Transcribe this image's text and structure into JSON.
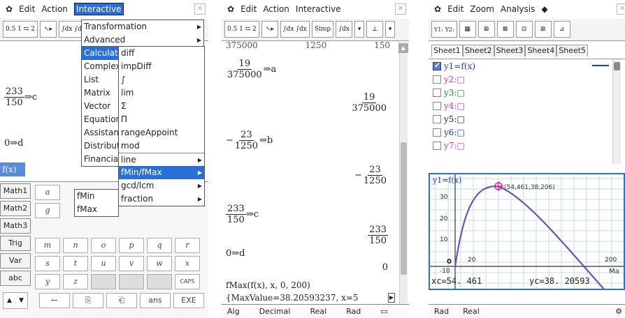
{
  "panel1": {
    "menubar": {
      "gear": "✿",
      "edit": "Edit",
      "action": "Action",
      "interactive": "Interactive"
    },
    "toolbar": [
      "0.5 1 ⇆ 2",
      "↖▸",
      "∫dx ∫dx"
    ],
    "work": {
      "frac_num": "233",
      "frac_den": "150",
      "assign1": "⇒c",
      "assign2": "0⇒d",
      "fx_tag": "f(x)"
    },
    "menu1": [
      "Transformation",
      "Advanced",
      "Calculation",
      "Complex",
      "List",
      "Matrix",
      "Vector",
      "Equation",
      "Assistant",
      "Distribution",
      "Financial"
    ],
    "menu2": [
      "diff",
      "impDiff",
      "∫",
      "lim",
      "Σ",
      "Π",
      "rangeAppoint",
      "mod",
      "line",
      "fMin/fMax",
      "gcd/lcm",
      "fraction"
    ],
    "menu3": [
      "fMin",
      "fMax"
    ],
    "keytabs": [
      "Math1",
      "Math2",
      "Math3",
      "Trig",
      "Var",
      "abc"
    ],
    "keys_row1": [
      "a",
      "g"
    ],
    "keys_row3": [
      "m",
      "n",
      "o",
      "p",
      "q",
      "r"
    ],
    "keys_row4": [
      "s",
      "t",
      "u",
      "v",
      "w",
      "x"
    ],
    "keys_row5": [
      "y",
      "z",
      "",
      "",
      "",
      "CAPS"
    ],
    "bottom_keys": [
      "←",
      "⎘",
      "⎗",
      "ans",
      "EXE"
    ],
    "scroll_up": "▲",
    "scroll_down": "▼"
  },
  "panel2": {
    "menubar": {
      "gear": "✿",
      "edit": "Edit",
      "action": "Action",
      "interactive": "Interactive"
    },
    "toolbar": [
      "0.5 1 ⇆ 2",
      "↖▸",
      "∫dx ∫dx",
      "Simp",
      "∫dx",
      "▾",
      "⊥",
      "▾"
    ],
    "top_row": [
      "375000",
      "1250",
      "150"
    ],
    "lines": {
      "a_num": "19",
      "a_den": "375000",
      "a_assign": "⇒a",
      "r1_num": "19",
      "r1_den": "375000",
      "b_sign": "−",
      "b_num": "23",
      "b_den": "1250",
      "b_assign": "⇒b",
      "r2_sign": "−",
      "r2_num": "23",
      "r2_den": "1250",
      "c_num": "233",
      "c_den": "150",
      "c_assign": "⇒c",
      "r3_num": "233",
      "r3_den": "150",
      "d_assign": "0⇒d",
      "r4": "0",
      "input": "fMax(f(x), x, 0, 200)",
      "output": "{MaxValue=38.20593237, x=5"
    },
    "status": [
      "Alg",
      "Decimal",
      "Real",
      "Rad",
      "▭"
    ]
  },
  "panel3": {
    "menubar": {
      "gear": "✿",
      "edit": "Edit",
      "zoom": "Zoom",
      "analysis": "Analysis",
      "diamond": "◆"
    },
    "toolbar": [
      "Y1: Y2:",
      "▦",
      "⊞",
      "⊠",
      "⊡",
      "⊞",
      "⊿"
    ],
    "sheets": [
      "Sheet1",
      "Sheet2",
      "Sheet3",
      "Sheet4",
      "Sheet5"
    ],
    "functions": [
      {
        "label": "y1=f(x)",
        "checked": true,
        "color": "#1a3bd0"
      },
      {
        "label": "y2:□",
        "checked": false,
        "color": "#c0389a"
      },
      {
        "label": "y3:□",
        "checked": false,
        "color": "#1a8a3a"
      },
      {
        "label": "y4:□",
        "checked": false,
        "color": "#b03ab8"
      },
      {
        "label": "y5:□",
        "checked": false,
        "color": "#222222"
      },
      {
        "label": "y6:□",
        "checked": false,
        "color": "#1a3bd0"
      },
      {
        "label": "y7:□",
        "checked": false,
        "color": "#c0389a"
      }
    ],
    "graph": {
      "title": "y1=f(x)",
      "point_label": "(54,461,38,206)",
      "y_ticks": [
        "30",
        "20",
        "10",
        "0",
        "-10"
      ],
      "x_ticks": [
        "20",
        "200"
      ],
      "xc": "xc=54. 461",
      "yc": "yc=38. 20593",
      "max": "Ma"
    },
    "status": [
      "Rad",
      "Real",
      "⚙"
    ]
  }
}
